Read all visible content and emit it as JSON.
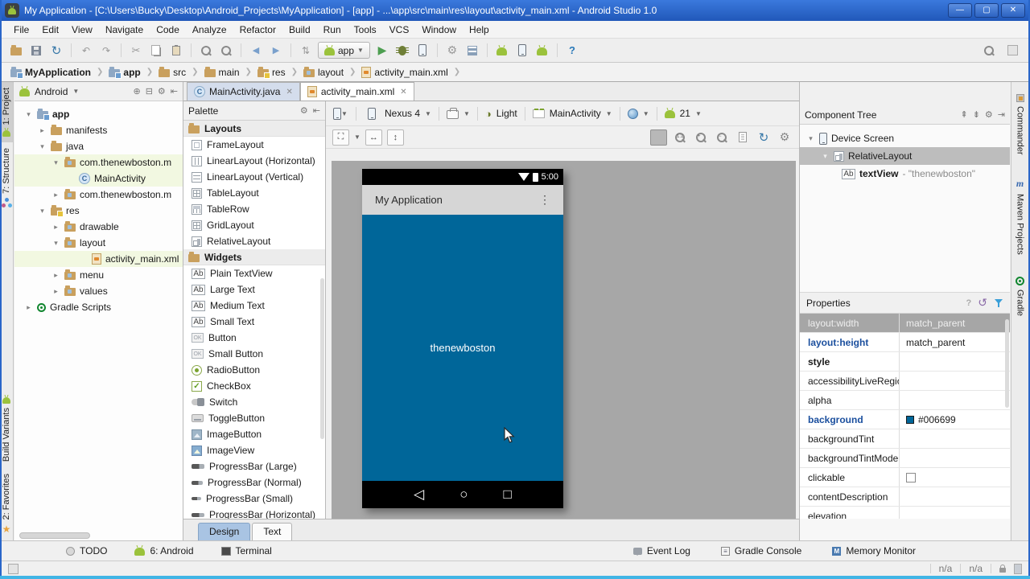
{
  "window": {
    "title": "My Application - [C:\\Users\\Bucky\\Desktop\\Android_Projects\\MyApplication] - [app] - ...\\app\\src\\main\\res\\layout\\activity_main.xml - Android Studio 1.0"
  },
  "menu": {
    "items": [
      "File",
      "Edit",
      "View",
      "Navigate",
      "Code",
      "Analyze",
      "Refactor",
      "Build",
      "Run",
      "Tools",
      "VCS",
      "Window",
      "Help"
    ]
  },
  "toolbar": {
    "run_config": "app"
  },
  "breadcrumbs": {
    "items": [
      "MyApplication",
      "app",
      "src",
      "main",
      "res",
      "layout",
      "activity_main.xml"
    ]
  },
  "left_strip": {
    "project": "1: Project",
    "structure": "7: Structure",
    "build_variants": "Build Variants",
    "favorites": "2: Favorites"
  },
  "right_strip": {
    "commander": "Commander",
    "maven": "Maven Projects",
    "gradle": "Gradle"
  },
  "project": {
    "view": "Android",
    "tree": [
      {
        "label": "app"
      },
      {
        "label": "manifests"
      },
      {
        "label": "java"
      },
      {
        "label": "com.thenewboston.m"
      },
      {
        "label": "MainActivity"
      },
      {
        "label": "com.thenewboston.m"
      },
      {
        "label": "res"
      },
      {
        "label": "drawable"
      },
      {
        "label": "layout"
      },
      {
        "label": "activity_main.xml"
      },
      {
        "label": "menu"
      },
      {
        "label": "values"
      },
      {
        "label": "Gradle Scripts"
      }
    ]
  },
  "editor": {
    "tabs": [
      {
        "label": "MainActivity.java"
      },
      {
        "label": "activity_main.xml"
      }
    ],
    "footer_tabs": {
      "design": "Design",
      "text": "Text"
    }
  },
  "palette": {
    "title": "Palette",
    "layouts_header": "Layouts",
    "widgets_header": "Widgets",
    "layouts": [
      "FrameLayout",
      "LinearLayout (Horizontal)",
      "LinearLayout (Vertical)",
      "TableLayout",
      "TableRow",
      "GridLayout",
      "RelativeLayout"
    ],
    "widgets": [
      "Plain TextView",
      "Large Text",
      "Medium Text",
      "Small Text",
      "Button",
      "Small Button",
      "RadioButton",
      "CheckBox",
      "Switch",
      "ToggleButton",
      "ImageButton",
      "ImageView",
      "ProgressBar (Large)",
      "ProgressBar (Normal)",
      "ProgressBar (Small)",
      "ProgressBar (Horizontal)"
    ]
  },
  "design_toolbar": {
    "device": "Nexus 4",
    "theme": "Light",
    "activity": "MainActivity",
    "api": "21"
  },
  "preview": {
    "time": "5:00",
    "app_title": "My Application",
    "content_text": "thenewboston",
    "background": "#006699"
  },
  "component_tree": {
    "title": "Component Tree",
    "device_screen": "Device Screen",
    "relative_layout": "RelativeLayout",
    "textview_label": "textView",
    "textview_suffix": "- \"thenewboston\""
  },
  "properties": {
    "title": "Properties",
    "rows": [
      {
        "name": "layout:width",
        "value": "match_parent"
      },
      {
        "name": "layout:height",
        "value": "match_parent"
      },
      {
        "name": "style",
        "value": ""
      },
      {
        "name": "accessibilityLiveRegion",
        "value": ""
      },
      {
        "name": "alpha",
        "value": ""
      },
      {
        "name": "background",
        "value": "#006699"
      },
      {
        "name": "backgroundTint",
        "value": ""
      },
      {
        "name": "backgroundTintMode",
        "value": ""
      },
      {
        "name": "clickable",
        "value": ""
      },
      {
        "name": "contentDescription",
        "value": ""
      },
      {
        "name": "elevation",
        "value": ""
      }
    ]
  },
  "bottom_bar": {
    "todo": "TODO",
    "android": "6: Android",
    "terminal": "Terminal",
    "event_log": "Event Log",
    "gradle_console": "Gradle Console",
    "memory_monitor": "Memory Monitor"
  },
  "status_bar": {
    "na1": "n/a",
    "na2": "n/a"
  },
  "colors": {
    "accent_blue": "#2a66c9",
    "preview_bg": "#006699"
  }
}
